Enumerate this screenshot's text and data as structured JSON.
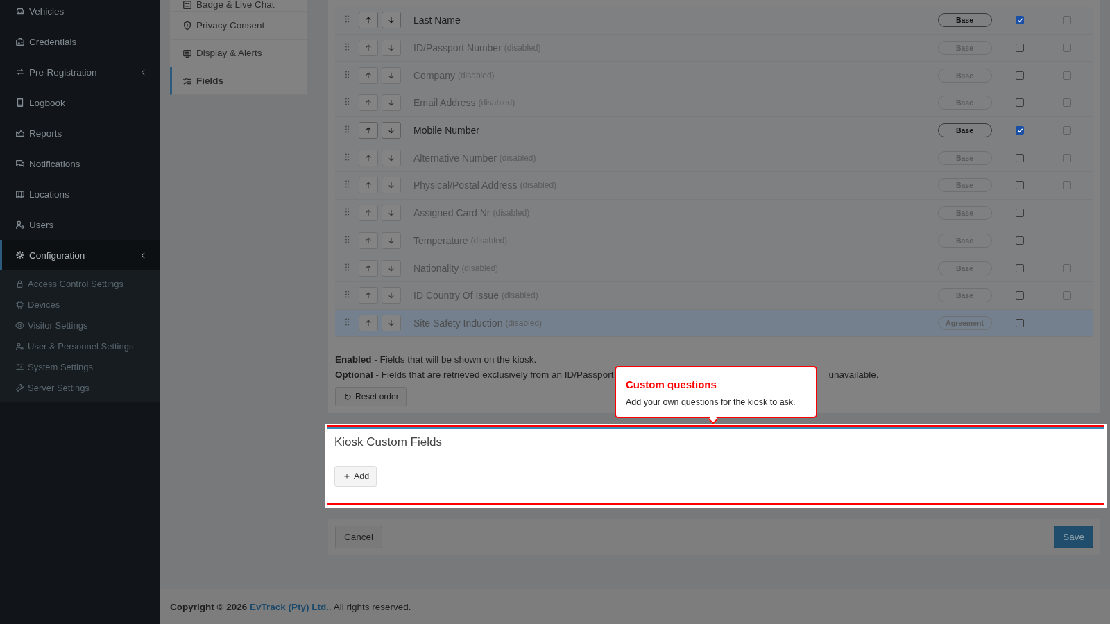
{
  "sidebar": {
    "items": [
      {
        "label": "Vehicles",
        "kind": "link",
        "selected": false
      },
      {
        "label": "Credentials",
        "kind": "link",
        "selected": false
      },
      {
        "label": "Pre-Registration",
        "kind": "group",
        "selected": false
      },
      {
        "label": "Logbook",
        "kind": "link",
        "selected": false
      },
      {
        "label": "Reports",
        "kind": "link",
        "selected": false
      },
      {
        "label": "Notifications",
        "kind": "link",
        "selected": false
      },
      {
        "label": "Locations",
        "kind": "link",
        "selected": false
      },
      {
        "label": "Users",
        "kind": "link",
        "selected": false
      },
      {
        "label": "Configuration",
        "kind": "group",
        "selected": true,
        "children": [
          {
            "label": "Access Control Settings",
            "selected": false
          },
          {
            "label": "Devices",
            "selected": false
          },
          {
            "label": "Visitor Settings",
            "selected": false
          },
          {
            "label": "User & Personnel Settings",
            "selected": false
          },
          {
            "label": "System Settings",
            "selected": false
          },
          {
            "label": "Server Settings",
            "selected": false
          }
        ]
      }
    ]
  },
  "settings_menu": {
    "items": [
      {
        "label": "Badge & Live Chat",
        "selected": false
      },
      {
        "label": "Privacy Consent",
        "selected": false
      },
      {
        "label": "Display & Alerts",
        "selected": false
      },
      {
        "label": "Fields",
        "selected": true
      }
    ]
  },
  "fields_table": {
    "rows": [
      {
        "label": "Last Name",
        "disabled": false,
        "badge": "Base",
        "enabled": true,
        "optional": false,
        "selected": false
      },
      {
        "label": "ID/Passport Number",
        "note": "(disabled)",
        "disabled": true,
        "badge": "Base",
        "enabled": false,
        "optional": false,
        "selected": false
      },
      {
        "label": "Company",
        "note": "(disabled)",
        "disabled": true,
        "badge": "Base",
        "enabled": false,
        "optional": false,
        "selected": false
      },
      {
        "label": "Email Address",
        "note": "(disabled)",
        "disabled": true,
        "badge": "Base",
        "enabled": false,
        "optional": false,
        "selected": false
      },
      {
        "label": "Mobile Number",
        "disabled": false,
        "badge": "Base",
        "enabled": true,
        "optional": false,
        "selected": false
      },
      {
        "label": "Alternative Number",
        "note": "(disabled)",
        "disabled": true,
        "badge": "Base",
        "enabled": false,
        "optional": false,
        "selected": false
      },
      {
        "label": "Physical/Postal Address",
        "note": "(disabled)",
        "disabled": true,
        "badge": "Base",
        "enabled": false,
        "optional": false,
        "selected": false
      },
      {
        "label": "Assigned Card Nr",
        "note": "(disabled)",
        "disabled": true,
        "badge": "Base",
        "enabled": false,
        "selected": false
      },
      {
        "label": "Temperature",
        "note": "(disabled)",
        "disabled": true,
        "badge": "Base",
        "enabled": false,
        "selected": false
      },
      {
        "label": "Nationality",
        "note": "(disabled)",
        "disabled": true,
        "badge": "Base",
        "enabled": false,
        "optional": false,
        "selected": false
      },
      {
        "label": "ID Country Of Issue",
        "note": "(disabled)",
        "disabled": true,
        "badge": "Base",
        "enabled": false,
        "optional": false,
        "selected": false
      },
      {
        "label": "Site Safety Induction",
        "note": "(disabled)",
        "disabled": true,
        "badge": "Agreement",
        "enabled": false,
        "selected": true
      }
    ]
  },
  "notes": [
    {
      "text": "**Enabled** - Fields that will be shown on the kiosk."
    },
    {
      "text": "**Optional** - Fields that are retrieved exclusively from an ID/Passport",
      "tail": "unavailable."
    }
  ],
  "reset_button": "Reset order",
  "custom_fields": {
    "title": "Kiosk Custom Fields",
    "add_button": "Add"
  },
  "tooltip": {
    "title": "Custom questions",
    "text": "Add your own questions for the kiosk to ask."
  },
  "buttons": {
    "cancel": "Cancel",
    "save": "Save"
  },
  "footer": {
    "prefix": "**Copyright © 2026**",
    "link": "EvTrack (Pty) Ltd.",
    "suffix": ". All rights reserved."
  }
}
